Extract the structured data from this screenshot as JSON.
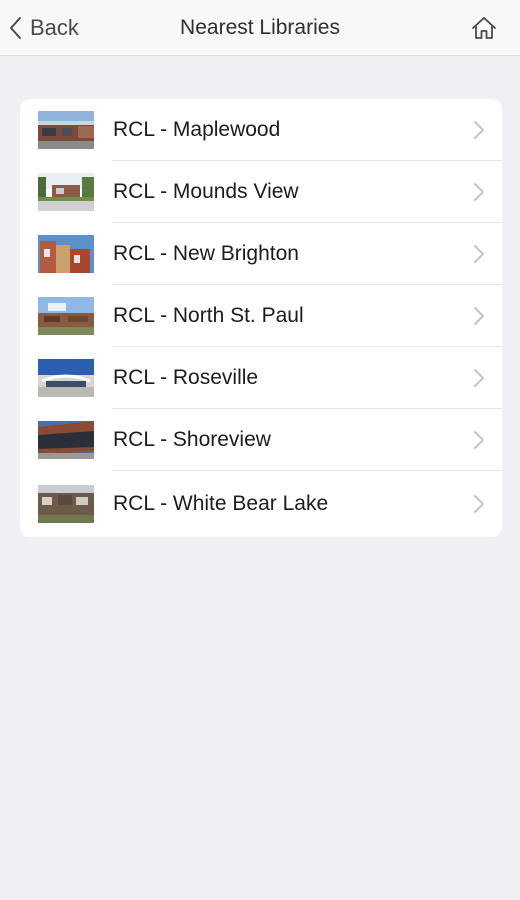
{
  "navbar": {
    "back_label": "Back",
    "title": "Nearest Libraries",
    "home_icon": "home-icon"
  },
  "libraries": [
    {
      "label": "RCL - Maplewood",
      "thumb": "library-photo-maplewood"
    },
    {
      "label": "RCL - Mounds View",
      "thumb": "library-photo-mounds-view"
    },
    {
      "label": "RCL - New Brighton",
      "thumb": "library-photo-new-brighton"
    },
    {
      "label": "RCL - North St. Paul",
      "thumb": "library-photo-north-st-paul"
    },
    {
      "label": "RCL - Roseville",
      "thumb": "library-photo-roseville"
    },
    {
      "label": "RCL - Shoreview",
      "thumb": "library-photo-shoreview"
    },
    {
      "label": "RCL - White Bear Lake",
      "thumb": "library-photo-white-bear-lake"
    }
  ],
  "colors": {
    "background": "#efeff4",
    "navbar": "#f8f8f8",
    "card": "#ffffff",
    "chevron": "#c4c4c8"
  }
}
